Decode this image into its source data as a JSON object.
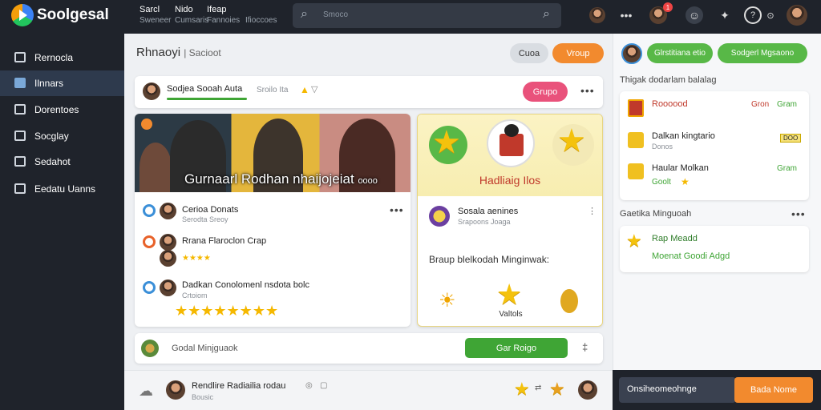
{
  "header": {
    "app_title": "Soolgesal",
    "nav": [
      {
        "title": "Sarcl",
        "sub": "Sweneer"
      },
      {
        "title": "Nido",
        "sub": "Cumsaris"
      },
      {
        "title": "Ifeap",
        "sub": "Fannoies"
      }
    ],
    "nav_extra": "Ifioccoes",
    "search_placeholder": "Smoco",
    "badges": {
      "notifications": "1",
      "messages": "1"
    },
    "profile_caret": "⊙"
  },
  "sidebar": {
    "items": [
      {
        "label": "Rernocla",
        "active": false
      },
      {
        "label": "Ilnnars",
        "active": true
      },
      {
        "label": "Dorentoes",
        "active": false
      },
      {
        "label": "Socglay",
        "active": false
      },
      {
        "label": "Sedahot",
        "active": false
      },
      {
        "label": "Eedatu Uanns",
        "active": false
      }
    ]
  },
  "main": {
    "title": "Rhnaoyi",
    "subtitle": "Sacioot",
    "btn_secondary": "Cuoa",
    "btn_primary": "Vroup",
    "post": {
      "author": "Sodjea Sooah Auta",
      "meta": "Sroilo Ita",
      "group_btn": "Grupo"
    },
    "feature_caption": "Gurnaarl Rodhan nhaijojeiat",
    "feature_caption_small": "oooo",
    "list": [
      {
        "name": "Cerioa Donats",
        "meta": "Serodta Sreoy",
        "stars": ""
      },
      {
        "name": "Rrana Flaroclon Crap",
        "meta": "",
        "stars": "★★★★"
      },
      {
        "name": "Dadkan Conolomenl nsdota bolc",
        "meta": "Crtoiom",
        "stars": "★★★★★★★★"
      }
    ],
    "badge_card": {
      "title": "Hadliaig Ilos",
      "user_name": "Sosala aenines",
      "user_meta": "Srapoons Joaga",
      "message": "Braup blelkodah Minginwak:",
      "value_label": "Valtols"
    },
    "composer": {
      "placeholder": "Godal Minjguaok",
      "button": "Gar Roigo"
    },
    "bottom_post": {
      "author": "Rendlire Radiailia rodau",
      "meta": "Bousic"
    }
  },
  "right_panel": {
    "btn1": "Glrstitiana etio",
    "btn2": "Sodgerl Mgsaono",
    "section_title": "Thigak dodarlam balalag",
    "rewards": [
      {
        "name": "Roooood",
        "tag1": "Gron",
        "tag2": "Gram"
      },
      {
        "name": "Dalkan kingtario",
        "meta": "Donos",
        "tag": "DOO"
      },
      {
        "name": "Haular Molkan",
        "meta": "Goolt",
        "tag": "Gram"
      }
    ],
    "section2_title": "Gaetika Minguoah",
    "highlight": {
      "title": "Rap Meadd",
      "meta": "Moenat Goodi Adgd"
    },
    "bottom_text": "Onsiheomeohnge",
    "bottom_button": "Bada Nome"
  },
  "colors": {
    "dark": "#1f232b",
    "orange": "#f28a2e",
    "green": "#3fa535",
    "pink": "#e9527b",
    "gold": "#f4c20d"
  }
}
